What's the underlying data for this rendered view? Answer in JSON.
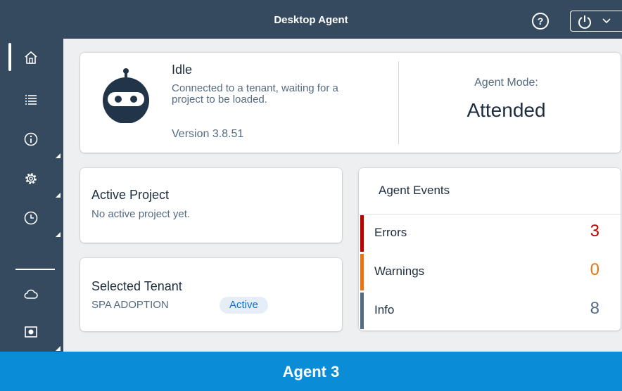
{
  "window": {
    "title": "Desktop Agent"
  },
  "titlebar": {
    "help_icon": "help-icon",
    "help_glyph": "?",
    "power_icon": "power-icon"
  },
  "sidebar": {
    "items": [
      {
        "icon": "home-icon",
        "active": true
      },
      {
        "icon": "list-icon",
        "active": false
      },
      {
        "icon": "info-icon",
        "active": false
      },
      {
        "icon": "settings-icon",
        "active": false
      },
      {
        "icon": "clock-icon",
        "active": false
      },
      {
        "icon": "cloud-icon",
        "active": false
      },
      {
        "icon": "record-icon",
        "active": false
      }
    ]
  },
  "status": {
    "title": "Idle",
    "description": "Connected to a tenant, waiting for a project to be loaded.",
    "version": "Version 3.8.51",
    "mode_label": "Agent Mode:",
    "mode_value": "Attended"
  },
  "project": {
    "title": "Active Project",
    "text": "No active project yet."
  },
  "tenant": {
    "title": "Selected Tenant",
    "name": "SPA ADOPTION",
    "badge": "Active"
  },
  "events": {
    "title": "Agent Events",
    "rows": [
      {
        "label": "Errors",
        "count": "3",
        "color": "#bb0000"
      },
      {
        "label": "Warnings",
        "count": "0",
        "color": "#e9730c"
      },
      {
        "label": "Info",
        "count": "8",
        "color": "#556b82"
      }
    ]
  },
  "footer": {
    "label": "Agent 3"
  },
  "colors": {
    "shell": "#354a5f",
    "footer": "#0a8cd6",
    "background": "#edeff0"
  }
}
